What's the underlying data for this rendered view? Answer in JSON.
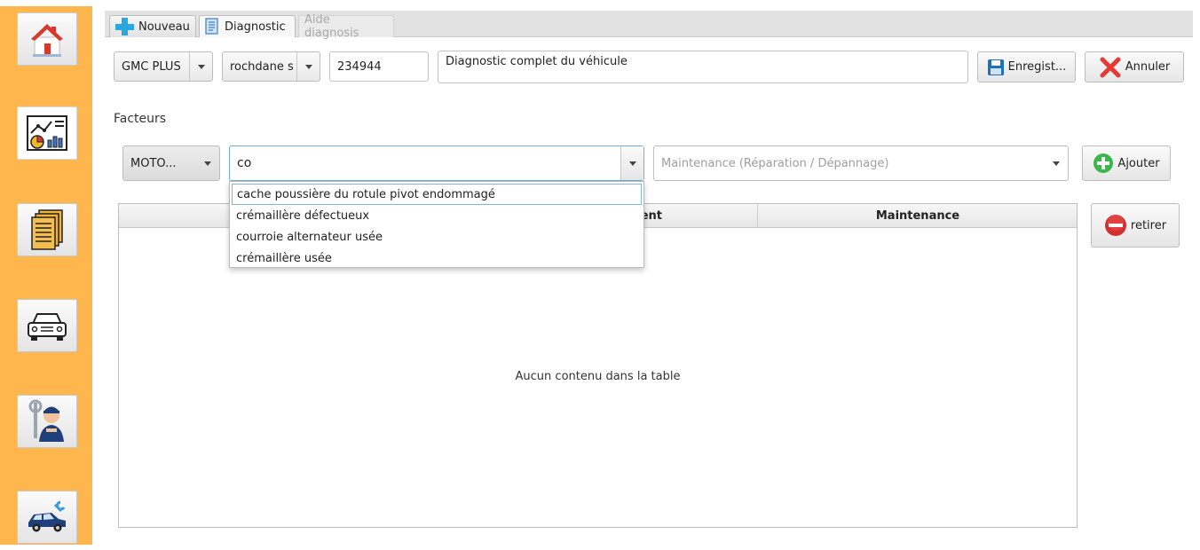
{
  "sidebar": {
    "items": [
      {
        "name": "home",
        "icon": "house-icon"
      },
      {
        "name": "dashboard",
        "icon": "chart-report-icon",
        "active": true
      },
      {
        "name": "documents",
        "icon": "documents-icon"
      },
      {
        "name": "vehicles",
        "icon": "car-icon"
      },
      {
        "name": "mechanics",
        "icon": "mechanic-icon"
      },
      {
        "name": "repairs",
        "icon": "car-repair-icon"
      }
    ],
    "color": "#ffb74d"
  },
  "tabs": [
    {
      "label": "Nouveau",
      "icon": "plus-icon"
    },
    {
      "label": "Diagnostic",
      "icon": "document-icon",
      "selected": true
    },
    {
      "label": "Aide diagnosis",
      "disabled": true
    }
  ],
  "form": {
    "vehicle": "GMC PLUS",
    "client": "rochdane s",
    "number": "234944",
    "description": "Diagnostic complet du véhicule",
    "save_label": "Enregist...",
    "cancel_label": "Annuler"
  },
  "factors": {
    "label": "Facteurs",
    "category": "MOTO...",
    "search_value": "co",
    "maintenance_placeholder": "Maintenance (Réparation / Dépannage)",
    "add_label": "Ajouter",
    "remove_label": "retirer"
  },
  "suggestions": [
    "cache poussière du rotule pivot endommagé",
    "crémaillère défectueux",
    "courroie alternateur usée",
    "crémaillère usée"
  ],
  "table": {
    "columns": [
      "",
      "ent",
      "Maintenance"
    ],
    "empty_message": "Aucun contenu dans la table"
  },
  "colors": {
    "add": "#3cb84a",
    "remove": "#d32f2f",
    "cancel": "#e53935",
    "save": "#1f6fbf",
    "plus": "#29a8e0"
  }
}
